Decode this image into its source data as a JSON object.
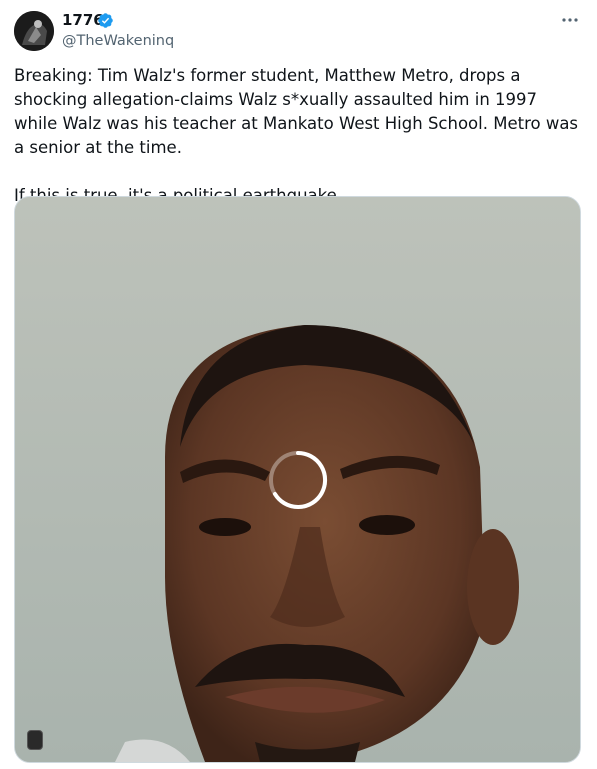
{
  "author": {
    "display_name": "1776",
    "handle": "@TheWakeninq",
    "verified": true,
    "verified_color": "#1d9bf0"
  },
  "tweet": {
    "paragraphs": [
      "Breaking: Tim Walz's former student, Matthew Metro, drops a shocking allegation-claims Walz s*xually assaulted him in 1997 while Walz was his teacher at Mankato West High School. Metro was a senior at the time.",
      "If this is true, it's a political earthquake."
    ]
  },
  "icons": {
    "more": "more-options-icon",
    "verified": "verified-badge-icon",
    "loading": "loading-spinner-icon"
  },
  "media": {
    "type": "video",
    "state": "loading"
  }
}
